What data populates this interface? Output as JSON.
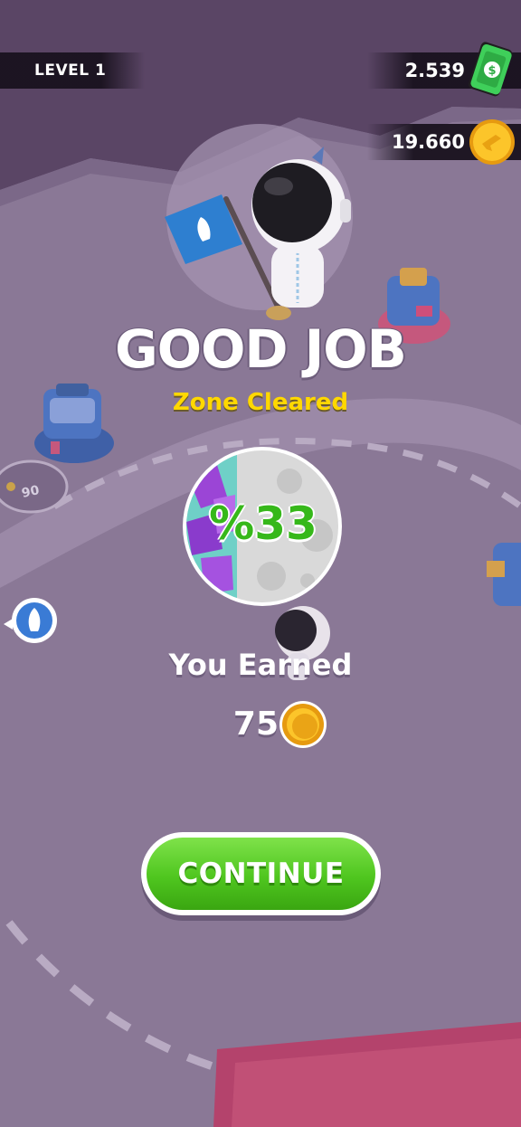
{
  "hud": {
    "level_label": "LEVEL 1",
    "cash_amount": "2.539",
    "coin_amount": "19.660"
  },
  "result": {
    "title": "GOOD JOB",
    "subtitle": "Zone Cleared",
    "progress_text": "%33",
    "progress_fraction": 0.33,
    "earned_label": "You Earned",
    "earned_amount": "75"
  },
  "map": {
    "zone_cost": "90"
  },
  "buttons": {
    "continue_label": "CONTINUE"
  },
  "icons": {
    "cash": "cash-bill-icon",
    "coin": "gold-coin-icon",
    "rocket_marker": "rocket-icon",
    "flag": "rocket-flag-icon"
  },
  "colors": {
    "title": "#ffffff",
    "subtitle": "#ffd800",
    "percent": "#36b81a",
    "button": "#4fc61f",
    "ground": "#8a7896"
  }
}
